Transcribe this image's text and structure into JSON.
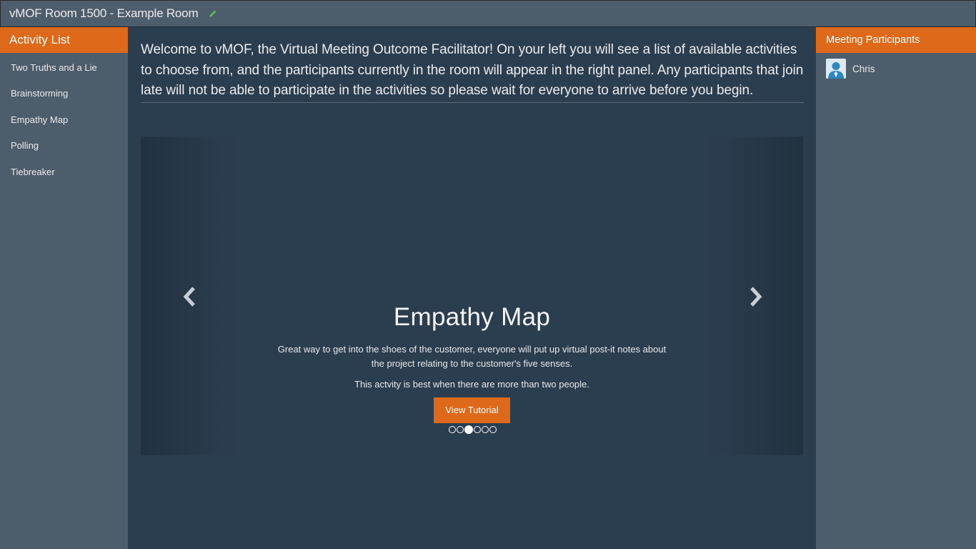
{
  "header": {
    "title": "vMOF Room 1500 - Example Room",
    "edit_icon": "pencil-icon",
    "edit_icon_color": "#5cb85c"
  },
  "activity_panel": {
    "title": "Activity List",
    "items": [
      {
        "label": "Two Truths and a Lie"
      },
      {
        "label": "Brainstorming"
      },
      {
        "label": "Empathy Map"
      },
      {
        "label": "Polling"
      },
      {
        "label": "Tiebreaker"
      }
    ]
  },
  "participants_panel": {
    "title": "Meeting Participants",
    "participants": [
      {
        "name": "Chris",
        "avatar_icon": "user-icon"
      }
    ]
  },
  "main": {
    "welcome_text": "Welcome to vMOF, the Virtual Meeting Outcome Facilitator! On your left you will see a list of available activities to choose from, and the participants currently in the room will appear in the right panel. Any participants that join late will not be able to participate in the activities so please wait for everyone to arrive before you begin."
  },
  "carousel": {
    "prev_icon": "chevron-left-icon",
    "next_icon": "chevron-right-icon",
    "slide_title": "Empathy Map",
    "slide_description": "Great way to get into the shoes of the customer, everyone will put up virtual post-it notes about the project relating to the customer's five senses.",
    "slide_note": "This actvity is best when there are more than two people.",
    "button_label": "View Tutorial",
    "slide_count": 6,
    "active_index": 2
  },
  "colors": {
    "accent": "#df691a",
    "panel": "#4e5d6c",
    "background": "#2b3e50"
  }
}
